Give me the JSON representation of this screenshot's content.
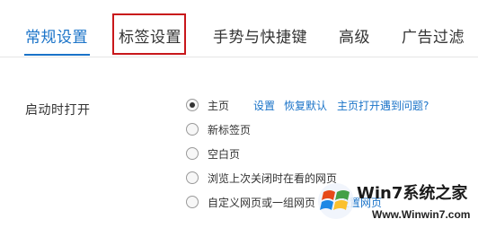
{
  "tabs": [
    {
      "label": "常规设置",
      "active": true
    },
    {
      "label": "标签设置",
      "active": false,
      "highlighted": true
    },
    {
      "label": "手势与快捷键",
      "active": false
    },
    {
      "label": "高级",
      "active": false
    },
    {
      "label": "广告过滤",
      "active": false
    }
  ],
  "startup": {
    "label": "启动时打开",
    "options": [
      {
        "label": "主页",
        "checked": true
      },
      {
        "label": "新标签页",
        "checked": false
      },
      {
        "label": "空白页",
        "checked": false
      },
      {
        "label": "浏览上次关闭时在看的网页",
        "checked": false
      },
      {
        "label": "自定义网页或一组网页",
        "checked": false
      }
    ],
    "links": {
      "settings": "设置",
      "restore_default": "恢复默认",
      "homepage_problem": "主页打开遇到问题?",
      "set_pages": "设置网页"
    }
  },
  "colors": {
    "accent": "#1a73c8",
    "highlight_border": "#c8171b",
    "text": "#333333"
  },
  "watermark": {
    "brand": "Win7系统之家",
    "url": "Www.Winwin7.com"
  }
}
